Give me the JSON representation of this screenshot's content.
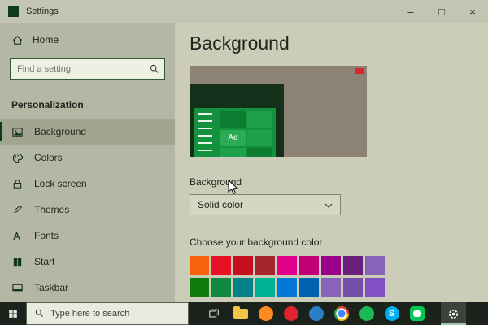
{
  "window": {
    "title": "Settings",
    "minimize_label": "–",
    "maximize_label": "□",
    "close_label": "×"
  },
  "sidebar": {
    "home_label": "Home",
    "search_placeholder": "Find a setting",
    "section_header": "Personalization",
    "items": [
      {
        "label": "Background",
        "icon": "image-icon",
        "active": true
      },
      {
        "label": "Colors",
        "icon": "palette-icon",
        "active": false
      },
      {
        "label": "Lock screen",
        "icon": "lock-icon",
        "active": false
      },
      {
        "label": "Themes",
        "icon": "brush-icon",
        "active": false
      },
      {
        "label": "Fonts",
        "icon": "fonts-icon",
        "active": false
      },
      {
        "label": "Start",
        "icon": "start-icon",
        "active": false
      },
      {
        "label": "Taskbar",
        "icon": "taskbar-icon",
        "active": false
      }
    ]
  },
  "main": {
    "title": "Background",
    "preview_sample_text": "Aa",
    "background_label": "Background",
    "background_type_value": "Solid color",
    "choose_color_label": "Choose your background color",
    "swatch_rows": [
      [
        "#f7630c",
        "#e81123",
        "#c50f1f",
        "#a4262c",
        "#e3008c",
        "#bf0077",
        "#9a0089",
        "#6b1f7b",
        "#8764b8"
      ],
      [
        "#107c10",
        "#10893e",
        "#038387",
        "#00b294",
        "#0078d7",
        "#0063b1",
        "#8764b8",
        "#744da9",
        "#8250c4"
      ]
    ]
  },
  "taskbar": {
    "search_placeholder": "Type here to search",
    "app_icons": [
      {
        "name": "file-explorer-icon",
        "style": "folder",
        "color": "#f3c545"
      },
      {
        "name": "firefox-icon",
        "style": "circle",
        "color": "#ff8a1e"
      },
      {
        "name": "opera-icon",
        "style": "circle",
        "color": "#e0242f"
      },
      {
        "name": "edge-icon",
        "style": "circle",
        "color": "#2a7fc5"
      },
      {
        "name": "chrome-icon",
        "style": "chrome",
        "color": "#4285f4"
      },
      {
        "name": "spotify-icon",
        "style": "circle",
        "color": "#1db954"
      },
      {
        "name": "skype-icon",
        "style": "circle",
        "color": "#00aff0",
        "glyph": "S"
      },
      {
        "name": "line-icon",
        "style": "rounded",
        "color": "#06c755"
      },
      {
        "name": "settings-icon",
        "style": "gear",
        "color": "#ffffff",
        "active": true
      }
    ]
  },
  "colors": {
    "accent_green": "#0f3a1f",
    "sidebar_bg": "#b4b7a4",
    "main_bg": "#cbcdb9",
    "taskbar_bg": "#1a221b",
    "preview_desktop_color": "#14301b"
  }
}
